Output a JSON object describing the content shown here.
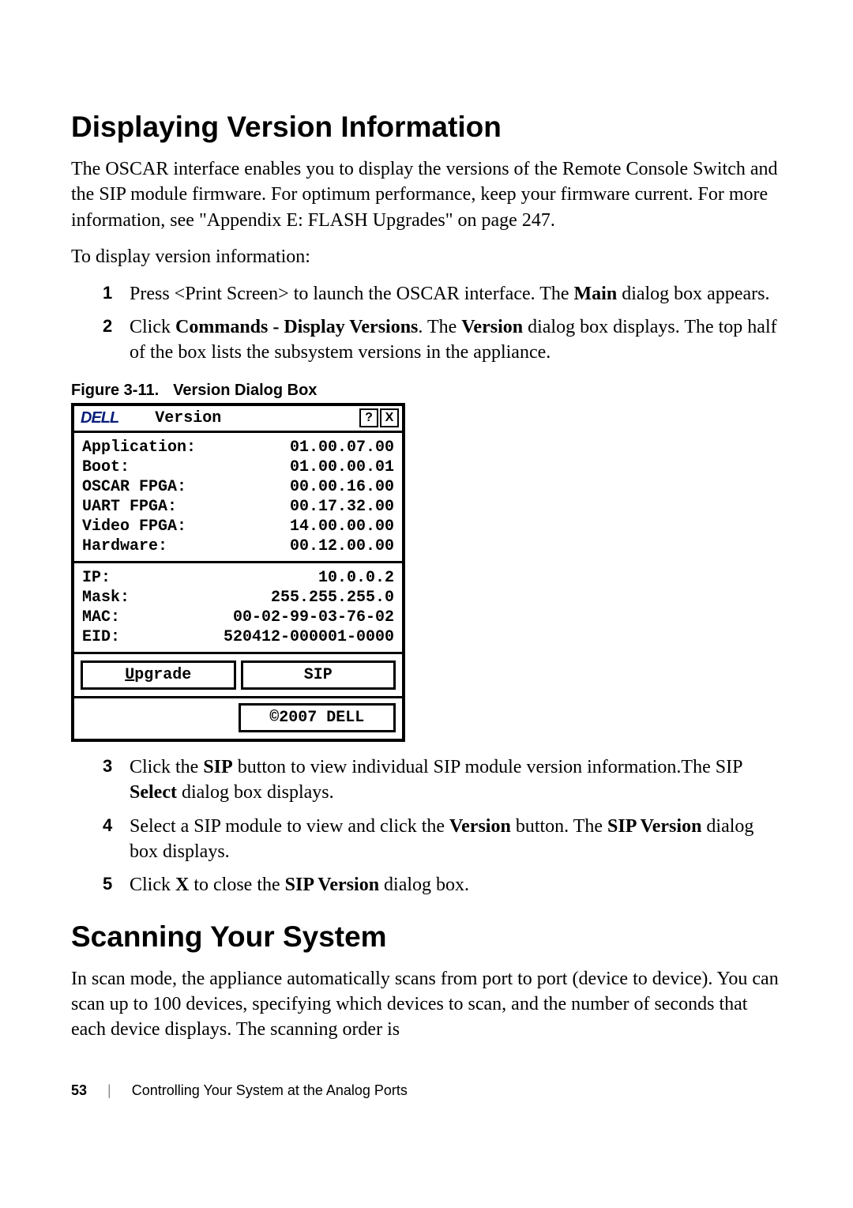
{
  "section1": {
    "heading": "Displaying Version Information",
    "para1": "The OSCAR interface enables you to display the versions of the Remote Console Switch and the SIP module firmware. For optimum performance, keep your firmware current. For more information, see \"Appendix E: FLASH Upgrades\" on page 247.",
    "para2": "To display version information:",
    "step1": {
      "num": "1",
      "text_a": "Press <Print Screen> to launch the OSCAR interface. The ",
      "bold_a": "Main",
      "text_b": " dialog box appears."
    },
    "step2": {
      "num": "2",
      "text_a": "Click ",
      "bold_a": "Commands - Display Versions",
      "text_b": ". ",
      "text_c": "The ",
      "bold_b": "Version",
      "text_d": " dialog box displays. The top half of the box lists the subsystem versions in the appliance."
    },
    "step3": {
      "num": "3",
      "text_a": "Click the ",
      "bold_a": "SIP",
      "text_b": " button to view individual SIP module version information.The SIP ",
      "bold_b": "Select",
      "text_c": " dialog box displays."
    },
    "step4": {
      "num": "4",
      "text_a": "Select a SIP module to view and click the ",
      "bold_a": "Version",
      "text_b": " button. The ",
      "bold_b": "SIP Version",
      "text_c": " dialog box displays."
    },
    "step5": {
      "num": "5",
      "text_a": "Click ",
      "bold_a": "X",
      "text_b": " to close the ",
      "bold_b": "SIP Version",
      "text_c": " dialog box."
    }
  },
  "figure": {
    "label": "Figure 3-11.",
    "title": "Version Dialog Box"
  },
  "dialog": {
    "logo": "DELL",
    "title": "Version",
    "help": "?",
    "close": "X",
    "versions": [
      {
        "label": "Application:",
        "value": "01.00.07.00"
      },
      {
        "label": "Boot:",
        "value": "01.00.00.01"
      },
      {
        "label": "OSCAR FPGA:",
        "value": "00.00.16.00"
      },
      {
        "label": "UART FPGA:",
        "value": "00.17.32.00"
      },
      {
        "label": "Video FPGA:",
        "value": "14.00.00.00"
      },
      {
        "label": "Hardware:",
        "value": "00.12.00.00"
      }
    ],
    "network": [
      {
        "label": "IP:",
        "value": "10.0.0.2"
      },
      {
        "label": "Mask:",
        "value": "255.255.255.0"
      },
      {
        "label": "MAC:",
        "value": "00-02-99-03-76-02"
      },
      {
        "label": "EID:",
        "value": "520412-000001-0000"
      }
    ],
    "upgrade_btn": "Upgrade",
    "sip_btn": "SIP",
    "copyright": "©2007 DELL"
  },
  "section2": {
    "heading": "Scanning Your System",
    "para1": "In scan mode, the appliance automatically scans from port to port (device to device). You can scan up to 100 devices, specifying which devices to scan, and the number of seconds that each device displays. The scanning order is"
  },
  "footer": {
    "page": "53",
    "divider": "|",
    "text": "Controlling Your System at the Analog Ports"
  }
}
